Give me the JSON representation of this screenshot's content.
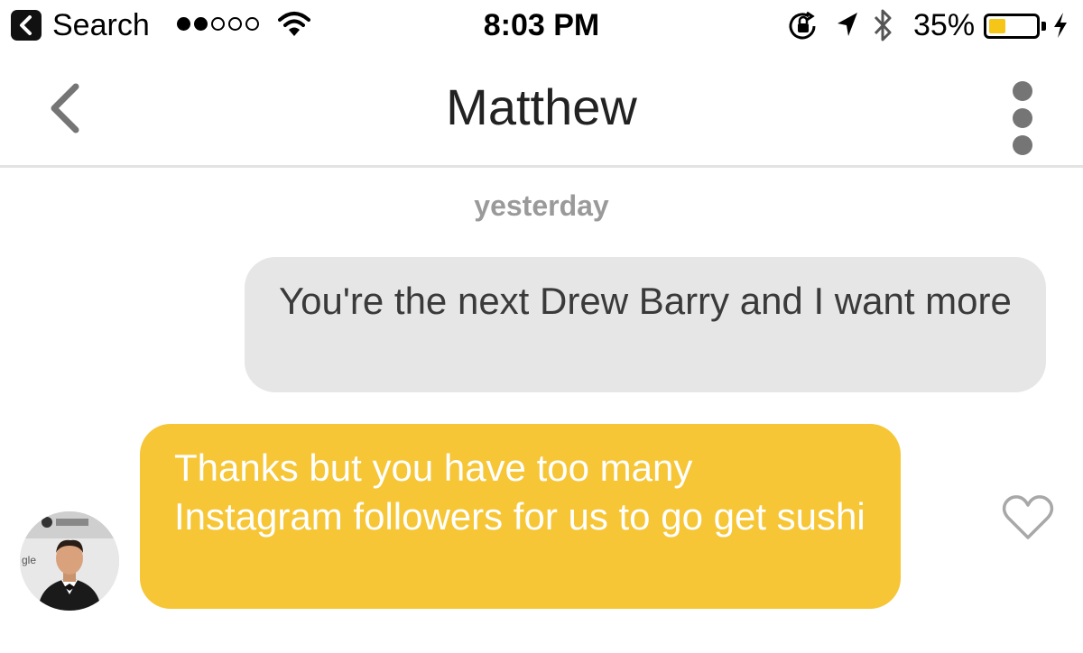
{
  "status_bar": {
    "back_app_label": "Search",
    "time": "8:03 PM",
    "battery_percent": "35%",
    "battery_level": 0.35,
    "battery_fill_color": "#f5c518",
    "signal_bars_filled": 2,
    "signal_bars_total": 5,
    "icons": [
      "back-chevron-icon",
      "wifi-icon",
      "rotation-lock-icon",
      "location-arrow-icon",
      "bluetooth-icon",
      "battery-icon",
      "charging-bolt-icon"
    ]
  },
  "nav": {
    "title": "Matthew",
    "back_icon": "chevron-left-icon",
    "more_icon": "vertical-dots-icon"
  },
  "conversation": {
    "timestamp": "yesterday",
    "messages": [
      {
        "direction": "outgoing",
        "text": "You're the next Drew Barry and I want more",
        "bubble_color": "#e6e6e6"
      },
      {
        "direction": "incoming",
        "text": "Thanks but you have too many Instagram followers for us to go get sushi",
        "bubble_color": "#f6c637"
      }
    ],
    "like_icon": "heart-outline-icon",
    "avatar_icon": "profile-photo"
  }
}
